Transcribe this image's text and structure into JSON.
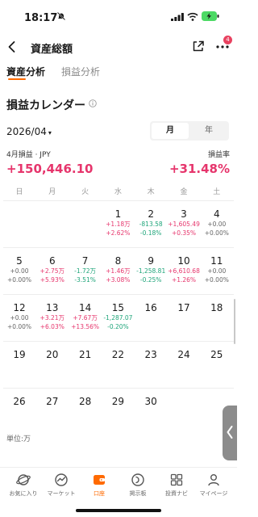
{
  "status": {
    "time": "18:17"
  },
  "nav": {
    "title": "資産総額",
    "badge": "4"
  },
  "tabs": [
    {
      "label": "資産分析",
      "active": true
    },
    {
      "label": "損益分析",
      "active": false
    }
  ],
  "section": {
    "title": "損益カレンダー"
  },
  "month_picker": {
    "value": "2026/04",
    "caret": "▾"
  },
  "segment": {
    "month": "月",
    "year": "年",
    "selected": "月"
  },
  "summary": {
    "pl_label": "4月損益 · JPY",
    "pl_value": "+150,446.10",
    "rate_label": "損益率",
    "rate_value": "+31.48%"
  },
  "weekdays": [
    "日",
    "月",
    "火",
    "水",
    "木",
    "金",
    "土"
  ],
  "calendar": [
    [
      {
        "day": ""
      },
      {
        "day": ""
      },
      {
        "day": ""
      },
      {
        "day": "1",
        "amt": "+1.18万",
        "pct": "+2.62%",
        "sign": "pos"
      },
      {
        "day": "2",
        "amt": "-813.58",
        "pct": "-0.18%",
        "sign": "neg"
      },
      {
        "day": "3",
        "amt": "+1,605.49",
        "pct": "+0.35%",
        "sign": "pos"
      },
      {
        "day": "4",
        "amt": "+0.00",
        "pct": "+0.00%",
        "sign": "zero"
      }
    ],
    [
      {
        "day": "5",
        "amt": "+0.00",
        "pct": "+0.00%",
        "sign": "zero"
      },
      {
        "day": "6",
        "amt": "+2.75万",
        "pct": "+5.93%",
        "sign": "pos"
      },
      {
        "day": "7",
        "amt": "-1.72万",
        "pct": "-3.51%",
        "sign": "neg"
      },
      {
        "day": "8",
        "amt": "+1.46万",
        "pct": "+3.08%",
        "sign": "pos"
      },
      {
        "day": "9",
        "amt": "-1,258.81",
        "pct": "-0.25%",
        "sign": "neg"
      },
      {
        "day": "10",
        "amt": "+6,610.68",
        "pct": "+1.26%",
        "sign": "pos"
      },
      {
        "day": "11",
        "amt": "+0.00",
        "pct": "+0.00%",
        "sign": "zero"
      }
    ],
    [
      {
        "day": "12",
        "amt": "+0.00",
        "pct": "+0.00%",
        "sign": "zero"
      },
      {
        "day": "13",
        "amt": "+3.21万",
        "pct": "+6.03%",
        "sign": "pos"
      },
      {
        "day": "14",
        "amt": "+7.67万",
        "pct": "+13.56%",
        "sign": "pos"
      },
      {
        "day": "15",
        "amt": "-1,287.07",
        "pct": "-0.20%",
        "sign": "neg"
      },
      {
        "day": "16"
      },
      {
        "day": "17"
      },
      {
        "day": "18"
      }
    ],
    [
      {
        "day": "19"
      },
      {
        "day": "20"
      },
      {
        "day": "21"
      },
      {
        "day": "22"
      },
      {
        "day": "23"
      },
      {
        "day": "24"
      },
      {
        "day": "25"
      }
    ],
    [
      {
        "day": "26"
      },
      {
        "day": "27"
      },
      {
        "day": "28"
      },
      {
        "day": "29"
      },
      {
        "day": "30"
      },
      {
        "day": ""
      },
      {
        "day": ""
      }
    ]
  ],
  "unit_label": "単位:万",
  "bottom_nav": [
    {
      "label": "お気に入り",
      "icon": "planet-icon",
      "active": false
    },
    {
      "label": "マーケット",
      "icon": "market-icon",
      "active": false
    },
    {
      "label": "口座",
      "icon": "wallet-icon",
      "active": true
    },
    {
      "label": "掲示板",
      "icon": "board-icon",
      "active": false
    },
    {
      "label": "投資ナビ",
      "icon": "grid-icon",
      "active": false
    },
    {
      "label": "マイページ",
      "icon": "person-icon",
      "active": false
    }
  ],
  "colors": {
    "positive": "#e6356c",
    "negative": "#1fa57a",
    "accent": "#ff6a00",
    "badge": "#e8415f"
  }
}
